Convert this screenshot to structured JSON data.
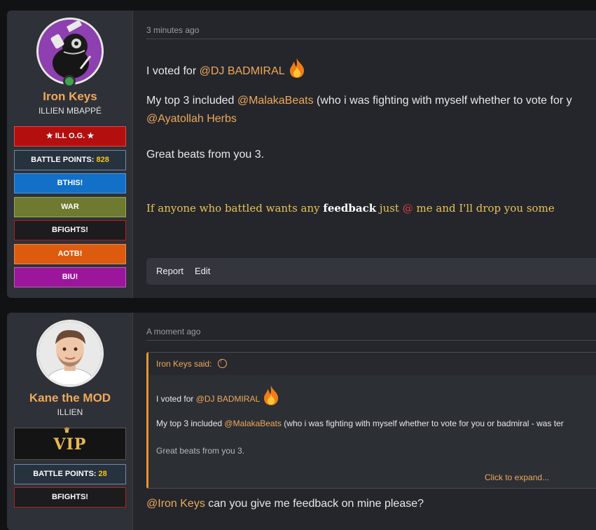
{
  "posts": [
    {
      "user": {
        "name": "Iron Keys",
        "title": "ILLIEN MBAPPÉ",
        "online": true
      },
      "banners": {
        "og": "ILL O.G.",
        "points_label": "BATTLE POINTS:",
        "points_value": "828",
        "bthis": "BTHIS!",
        "war": "WAR",
        "bfights": "BFIGHTS!",
        "aotb": "AOTB!",
        "biu": "BIU!"
      },
      "time": "3 minutes ago",
      "body": {
        "l1_pre": "I voted for ",
        "l1_mention": "@DJ BADMIRAL",
        "l2_pre": "My top 3 included ",
        "l2_mention": "@MalakaBeats",
        "l2_post": " (who i was fighting with myself whether to vote for y",
        "l3_mention": "@Ayatollah Herbs",
        "l4": "Great beats from you 3.",
        "l5_pre": "If anyone who battled wants any ",
        "l5_bold": "feedback",
        "l5_mid": " just ",
        "l5_at": "@",
        "l5_post": " me and I'll drop you some"
      },
      "actions": {
        "report": "Report",
        "edit": "Edit"
      }
    },
    {
      "user": {
        "name": "Kane the MOD",
        "title": "ILLIEN"
      },
      "banners": {
        "vip": "VIP",
        "points_label": "BATTLE POINTS:",
        "points_value": "28",
        "bfights": "BFIGHTS!"
      },
      "time": "A moment ago",
      "quote": {
        "author": "Iron Keys said:",
        "l1_pre": "I voted for ",
        "l1_mention": "@DJ BADMIRAL",
        "l2_pre": "My top 3 included ",
        "l2_mention": "@MalakaBeats",
        "l2_post": " (who i was fighting with myself whether to vote for you or badmiral - was ter",
        "l3": "Great beats from you 3.",
        "expand": "Click to expand..."
      },
      "reply": {
        "mention": "@Iron Keys",
        "text": " can you give me feedback on mine please?"
      }
    }
  ]
}
